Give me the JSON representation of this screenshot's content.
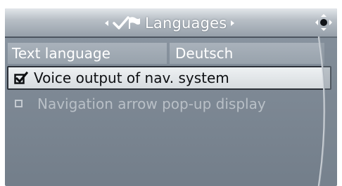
{
  "header": {
    "title": "Languages",
    "title_icon": "checkmark-flag-icon",
    "nav_control_icon": "controller-dot-icon"
  },
  "language_row": {
    "label": "Text language",
    "value": "Deutsch"
  },
  "options": [
    {
      "label": "Voice output of nav. system",
      "checked": true,
      "enabled": true
    },
    {
      "label": "Navigation arrow pop-up display",
      "checked": false,
      "enabled": false
    }
  ],
  "colors": {
    "screen_bg": "#8f9aa6",
    "highlight_bg": "#eef1f3",
    "text": "#ffffff",
    "disabled_text": "#b9c0c7"
  }
}
